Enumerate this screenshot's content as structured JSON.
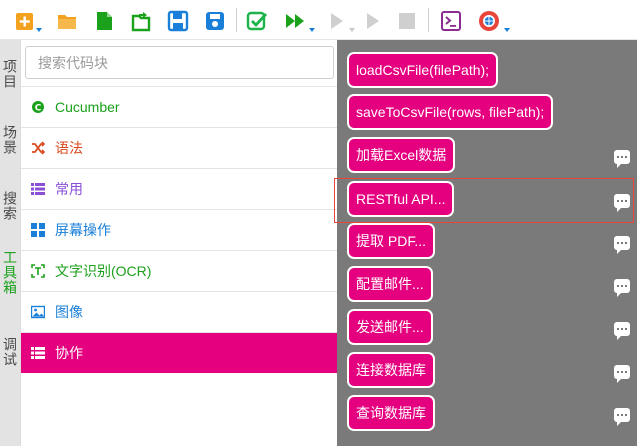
{
  "toolbar": {
    "buttons": [
      {
        "name": "new-project-icon",
        "color": "#f3a21f"
      },
      {
        "name": "open-folder-icon",
        "color": "#f3a21f"
      },
      {
        "name": "new-file-icon",
        "color": "#1ba11b"
      },
      {
        "name": "open-file-icon",
        "color": "#1ba11b"
      },
      {
        "name": "save-icon",
        "color": "#1a7fd8"
      },
      {
        "name": "save-all-icon",
        "color": "#1a7fd8"
      },
      {
        "name": "check-icon",
        "color": "#1bb34a"
      },
      {
        "name": "run-icon",
        "color": "#1ba11b"
      },
      {
        "name": "run-step-icon",
        "color": "#c8c8c8"
      },
      {
        "name": "play-icon",
        "color": "#c8c8c8"
      },
      {
        "name": "stop-icon",
        "color": "#c8c8c8"
      },
      {
        "name": "terminal-icon",
        "color": "#8a2c8f"
      },
      {
        "name": "browser-icon",
        "color": "#e8443a"
      }
    ]
  },
  "vtabs": [
    {
      "label": "项目",
      "active": false
    },
    {
      "label": "场景",
      "active": false
    },
    {
      "label": "搜索",
      "active": false
    },
    {
      "label": "工具箱",
      "active": true
    },
    {
      "label": "调试",
      "active": false
    }
  ],
  "search": {
    "placeholder": "搜索代码块"
  },
  "categories": [
    {
      "label": "Cucumber",
      "icon": "cucumber-icon",
      "color": "#1ba11b",
      "active": false
    },
    {
      "label": "语法",
      "icon": "shuffle-icon",
      "color": "#d94a1e",
      "active": false
    },
    {
      "label": "常用",
      "icon": "list-icon",
      "color": "#8a4fd6",
      "active": false
    },
    {
      "label": "屏幕操作",
      "icon": "grid-icon",
      "color": "#1a7fd8",
      "active": false
    },
    {
      "label": "文字识别(OCR)",
      "icon": "ocr-icon",
      "color": "#1ba11b",
      "active": false
    },
    {
      "label": "图像",
      "icon": "image-icon",
      "color": "#1a7fd8",
      "active": false
    },
    {
      "label": "协作",
      "icon": "list-icon",
      "color": "#ffffff",
      "active": true
    }
  ],
  "commands": [
    {
      "label": "loadCsvFile(filePath);",
      "comment": false
    },
    {
      "label": "saveToCsvFile(rows, filePath);",
      "comment": false
    },
    {
      "label": "加载Excel数据",
      "comment": true
    },
    {
      "label": "RESTful API...",
      "comment": true,
      "highlighted": true
    },
    {
      "label": "提取 PDF...",
      "comment": true
    },
    {
      "label": "配置邮件...",
      "comment": true
    },
    {
      "label": "发送邮件...",
      "comment": true
    },
    {
      "label": "连接数据库",
      "comment": true
    },
    {
      "label": "查询数据库",
      "comment": true
    }
  ]
}
